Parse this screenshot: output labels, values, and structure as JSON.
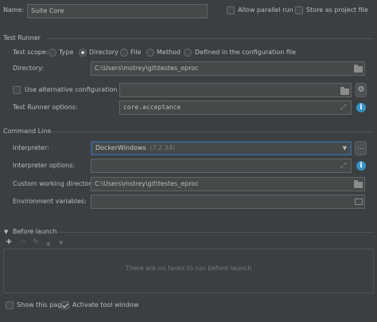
{
  "header": {
    "name_label": "Name:",
    "name_value": "Suite Core",
    "allow_parallel_label": "Allow parallel run",
    "store_project_label": "Store as project file",
    "allow_parallel_checked": false,
    "store_project_checked": false
  },
  "test_runner": {
    "section_title": "Test Runner",
    "scope_label": "Test scope:",
    "scope_options": [
      "Type",
      "Directory",
      "File",
      "Method",
      "Defined in the configuration file"
    ],
    "scope_selected": "Directory",
    "directory_label": "Directory:",
    "directory_value": "C:\\Users\\mstrey\\git\\testes_eproc",
    "alt_config_label": "Use alternative configuration file:",
    "alt_config_value": "",
    "options_label": "Test Runner options:",
    "options_value": "core.acceptance"
  },
  "command_line": {
    "section_title": "Command Line",
    "interpreter_label": "Interpreter:",
    "interpreter_value": "DockerWindows",
    "interpreter_version": "(7.2.34)",
    "interpreter_more": "...",
    "interpreter_options_label": "Interpreter options:",
    "interpreter_options_value": "",
    "working_dir_label": "Custom working directory:",
    "working_dir_value": "C:\\Users\\mstrey\\git\\testes_eproc",
    "env_vars_label": "Environment variables:",
    "env_vars_value": ""
  },
  "before_launch": {
    "section_title": "Before launch",
    "empty_text": "There are no tasks to run before launch",
    "toolbar": {
      "add": "+",
      "remove": "−",
      "edit": "✎",
      "up": "▲",
      "down": "▼"
    }
  },
  "footer": {
    "show_page_label": "Show this page",
    "activate_tool_label": "Activate tool window",
    "show_page_checked": false,
    "activate_tool_checked": true
  },
  "colors": {
    "background": "#3c3f41",
    "field": "#45494a",
    "info": "#3592c4",
    "focus": "#3d6185"
  }
}
